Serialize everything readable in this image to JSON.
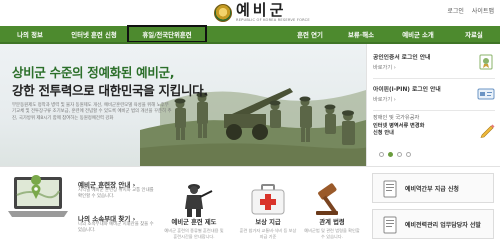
{
  "header": {
    "logo_name": "예비군",
    "logo_sub": "REPUBLIC OF KOREA RESERVE FORCE",
    "util_links": [
      "로그인",
      "사이트맵"
    ]
  },
  "nav": {
    "items": [
      "나의 정보",
      "인터넷 훈련 신청",
      "휴일/전국단위훈련",
      "훈련 연기",
      "보류·해소",
      "예비군 소개",
      "자료실"
    ],
    "active_index": 2,
    "color": "#4d8a2e"
  },
  "hero": {
    "title_line1": "상비군 수준의 정예화된 예비군,",
    "title_line2": "강한 전투력으로 대한민국을 지킵니다.",
    "description": "부분동원제도 정착과 병력 및 물자 동원제도 개선, 예비군훈련모델 육성을 위해 노후무기교체 및 전투장구류 조기보급, 훈련에 전념할 수 있도록 예비군 법의 개선을 꾸준히 추진, 국가방위 제8시기 함께 참여하는 동원정예전력 강화"
  },
  "side_panel": {
    "items": [
      {
        "title": "공인인증서 로그인 안내",
        "link": "바로가기 ›",
        "icon": "certificate-icon"
      },
      {
        "title": "아이핀(i-PIN) 로그인 안내",
        "link": "바로가기 ›",
        "icon": "ipin-card-icon"
      }
    ],
    "notice_line1": "장애인 및 국가유공자",
    "notice_line2": "인터넷 병역서류 변경화",
    "notice_line3": "신청 안내",
    "notice_icon": "pencil-icon",
    "carousel_active": 1,
    "carousel_count": 4
  },
  "bottom": {
    "map": {
      "title": "예비군 훈련장 안내 ›",
      "desc": "지역별 예비군 훈련장 위치와 교통 안내를 확인할 수 있습니다."
    },
    "unit": {
      "title": "나의 소속부대 찾기 ›",
      "desc": "나의 소속부대와 예비군 지휘관을 찾을 수 있습니다."
    },
    "quick_links": [
      {
        "label": "예비군 훈련 제도",
        "desc": "예비군 훈련의 종류별 훈련내용 및 훈련시간을 안내합니다.",
        "icon": "soldier-icon"
      },
      {
        "label": "보상 지급",
        "desc": "훈련 참가자 교통비·식비 등 보상 지급 기준",
        "icon": "first-aid-kit-icon"
      },
      {
        "label": "관계 법령",
        "desc": "예비군법 및 관련 법령을 확인할 수 있습니다.",
        "icon": "gavel-icon"
      }
    ],
    "services": [
      {
        "label": "예비역간부 지급 신청",
        "icon": "document-icon"
      },
      {
        "label": "예비전력관리 업무담당자 선발",
        "icon": "document-icon"
      }
    ]
  }
}
